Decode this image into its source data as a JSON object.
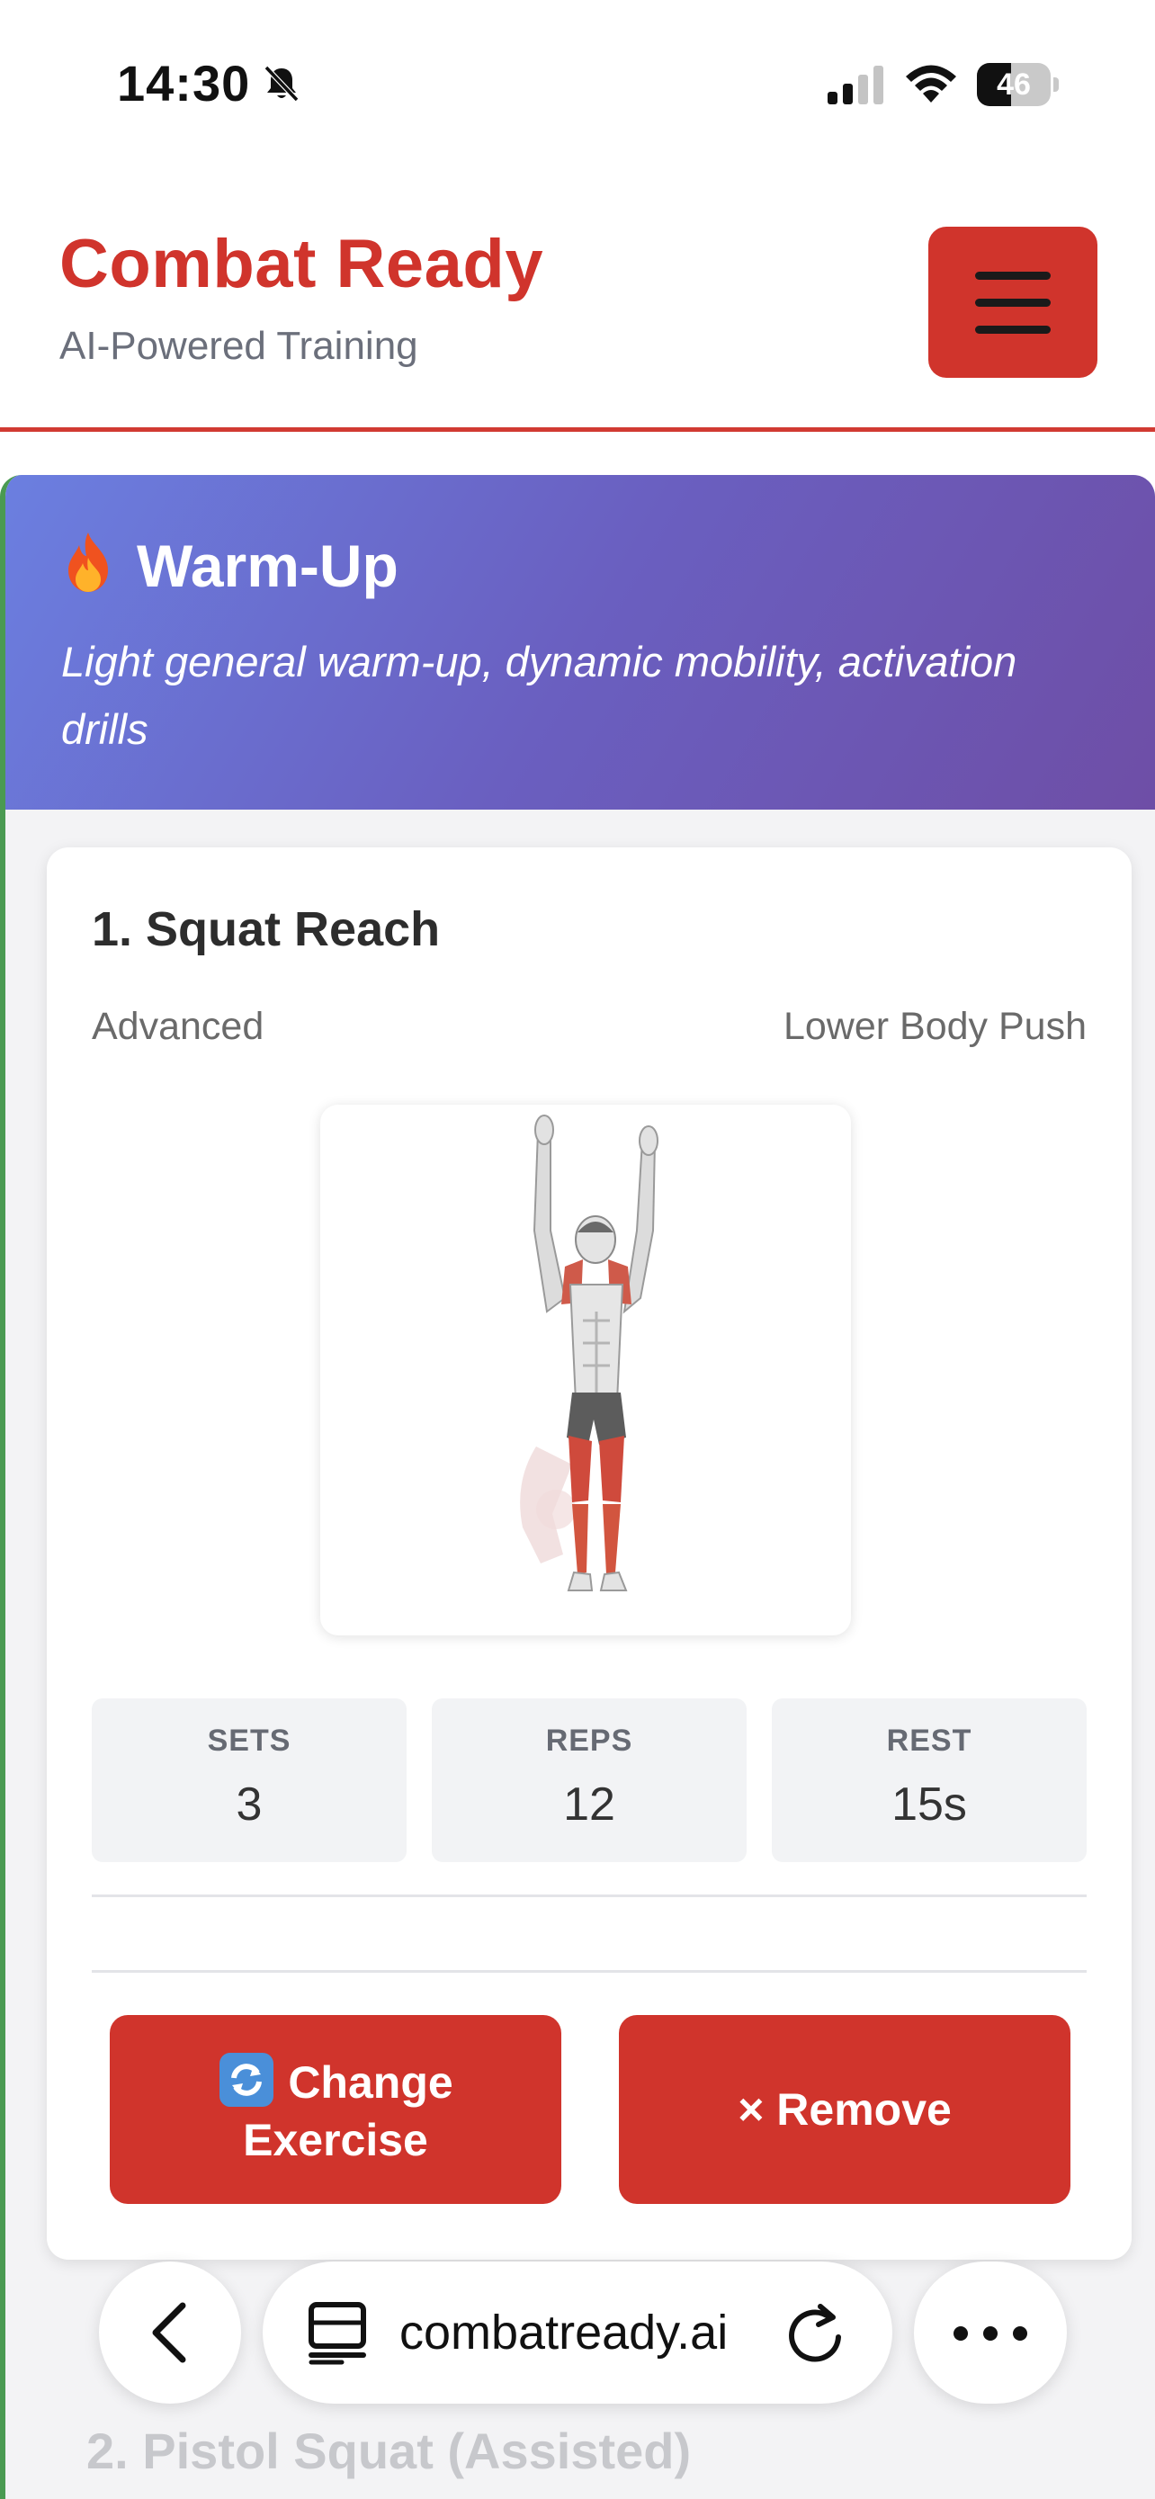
{
  "status_bar": {
    "time": "14:30",
    "battery_level": "46",
    "battery_fraction": 0.46,
    "icons": [
      "bell-slash-icon",
      "cellular-signal-icon",
      "wifi-icon",
      "battery-icon"
    ]
  },
  "header": {
    "title": "Combat Ready",
    "subtitle": "AI-Powered Training",
    "menu_icon": "hamburger-menu-icon"
  },
  "section": {
    "icon": "fire-icon",
    "title": "Warm-Up",
    "description": "Light general warm-up, dynamic mobility, activation drills"
  },
  "exercise": {
    "name": "1. Squat Reach",
    "level": "Advanced",
    "category": "Lower Body Push",
    "image_icon": "squat-reach-figure-icon",
    "stats": [
      {
        "label": "SETS",
        "value": "3"
      },
      {
        "label": "REPS",
        "value": "12"
      },
      {
        "label": "REST",
        "value": "15s"
      }
    ],
    "change_label": "Change Exercise",
    "remove_label": "× Remove"
  },
  "next_exercise": {
    "name": "2. Pistol Squat (Assisted)"
  },
  "browser": {
    "url": "combatready.ai"
  },
  "colors": {
    "brand_red": "#d0342c",
    "banner_start": "#6b7fe0",
    "banner_end": "#6e4ea6",
    "section_accent": "#4a9a52"
  }
}
